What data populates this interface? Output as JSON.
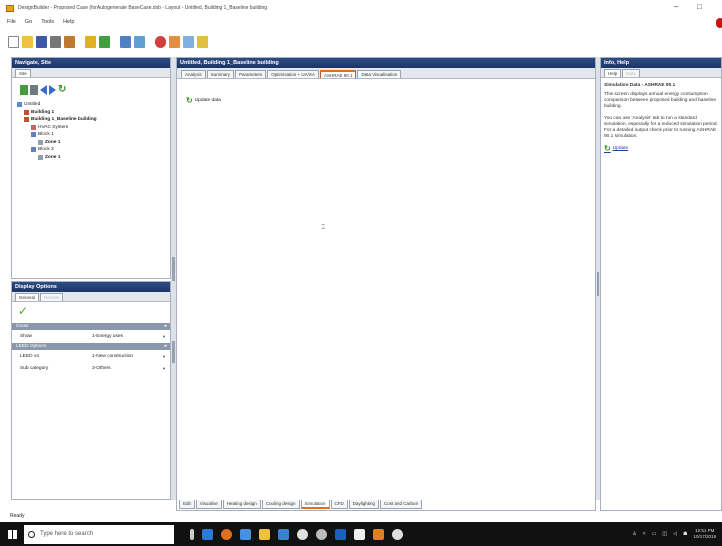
{
  "window": {
    "title": "DesignBuilder - Proposed Case (forAutogenerate BaseCase.dsb - Layout - Untitled, Building 1_Baseline building",
    "min_glyph": "–",
    "max_glyph": "□"
  },
  "menu": [
    "File",
    "Go",
    "Tools",
    "Help"
  ],
  "navigate": {
    "header": "Navigate, Site",
    "tab": "Site",
    "tree": [
      {
        "label": "Untitled",
        "level": 0,
        "bold": false
      },
      {
        "label": "Building 1",
        "level": 1,
        "bold": true
      },
      {
        "label": "Building 1_Baseline building",
        "level": 1,
        "bold": true
      },
      {
        "label": "HVAC System",
        "level": 2,
        "bold": false
      },
      {
        "label": "Block 1",
        "level": 2,
        "bold": false
      },
      {
        "label": "Zone 1",
        "level": 3,
        "bold": true
      },
      {
        "label": "Block 2",
        "level": 2,
        "bold": false
      },
      {
        "label": "Zone 1",
        "level": 3,
        "bold": true
      }
    ]
  },
  "display": {
    "header": "Display Options",
    "tabs": [
      "General",
      "Results"
    ],
    "sections": [
      {
        "title": "Cross",
        "rows": [
          {
            "label": "Show",
            "value": "1-Energy uses"
          }
        ]
      },
      {
        "title": "LEED Options",
        "rows": [
          {
            "label": "LEED v4",
            "value": "1-New construction"
          },
          {
            "label": "Sub category",
            "value": "3-Others"
          }
        ]
      }
    ]
  },
  "center": {
    "header": "Untitled, Building 1_Baseline building",
    "tabs": [
      "Analysis",
      "Summary",
      "Parameters",
      "Optimisation + UA/SA",
      "ASHRAE 90.1",
      "Data Visualisation"
    ],
    "active_tab": 4,
    "update_label": "Update data",
    "bottom_tabs": [
      "Edit",
      "Visualise",
      "Heating design",
      "Cooling design",
      "Simulation",
      "CFD",
      "Daylighting",
      "Cost and Carbon"
    ],
    "active_bottom_tab": 4
  },
  "info": {
    "header": "Info, Help",
    "tabs": [
      "Help",
      "Data"
    ],
    "heading": "Simulation Data - ASHRAE 90.1",
    "para1": "This screen displays annual energy consumption comparison between proposed building and baseline building.",
    "para2": "You can use 'Analysis' tab to run a standard simulation, especially for a reduced simulation period. For a detailed output check prior to running ASHRAE 90.1 simulation.",
    "link": "Update"
  },
  "status": "Ready",
  "taskbar": {
    "search_placeholder": "Type here to search",
    "time": "12:51 PM",
    "date": "10/17/2019"
  },
  "colors": {
    "header_blue": "#1c3568",
    "accent_orange": "#e07020",
    "green": "#3a9a2a"
  }
}
